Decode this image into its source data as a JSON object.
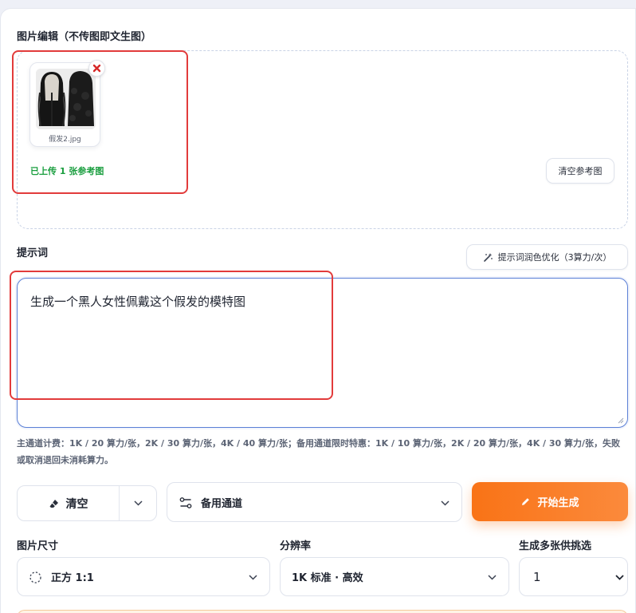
{
  "image_edit": {
    "label": "图片编辑（不传图即文生图）",
    "file_name": "假发2.jpg",
    "upload_status": "已上传 1 张参考图",
    "clear_refs_label": "清空参考图"
  },
  "prompt": {
    "label": "提示词",
    "optimize_label": "提示词润色优化（3算力/次）",
    "value": "生成一个黑人女性佩戴这个假发的模特图"
  },
  "pricing_note": "主通道计费：1K / 20 算力/张，2K / 30 算力/张，4K / 40 算力/张；备用通道限时特惠：1K / 10 算力/张，2K / 20 算力/张，4K / 30 算力/张，失败或取消退回未消耗算力。",
  "actions": {
    "clear_label": "清空",
    "channel_value": "备用通道",
    "generate_label": "开始生成"
  },
  "settings": {
    "size_label": "图片尺寸",
    "size_value": "正方 1:1",
    "resolution_label": "分辨率",
    "resolution_value": "1K 标准 · 高效",
    "count_label": "生成多张供挑选",
    "count_value": "1"
  },
  "colors": {
    "accent_orange": "#f97316",
    "success_green": "#1a9e3f",
    "annotation_red": "#e23b3b",
    "focus_blue": "#5a7fd6"
  },
  "icons": {
    "remove": "close-x-icon",
    "optimize": "magic-wand-icon",
    "clear": "eraser-icon",
    "channel": "route-icon",
    "generate": "pencil-icon",
    "size": "dashed-circle-icon"
  }
}
